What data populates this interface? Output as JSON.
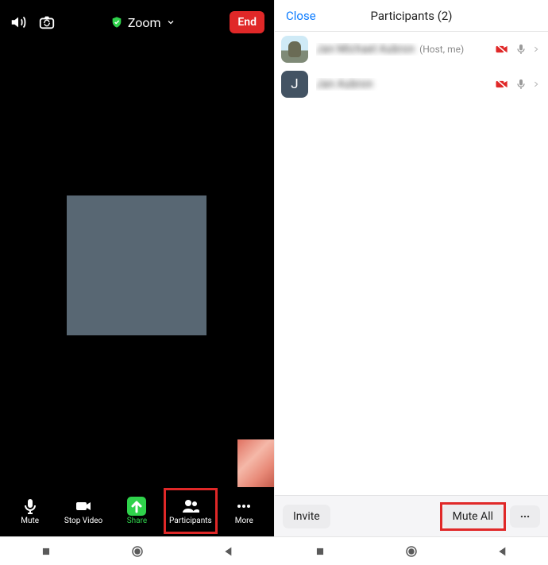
{
  "zoom": {
    "title": "Zoom",
    "end_label": "End",
    "controls": {
      "mute": "Mute",
      "stop_video": "Stop Video",
      "share": "Share",
      "participants": "Participants",
      "more": "More"
    }
  },
  "participants_panel": {
    "close_label": "Close",
    "title": "Participants (2)",
    "rows": [
      {
        "name": "Jan Michael Aubron",
        "meta": "(Host, me)",
        "avatar_initial": "",
        "video_off": true,
        "muted": true
      },
      {
        "name": "Jan Aubron",
        "meta": "",
        "avatar_initial": "J",
        "video_off": true,
        "muted": true
      }
    ],
    "invite_label": "Invite",
    "mute_all_label": "Mute All"
  }
}
